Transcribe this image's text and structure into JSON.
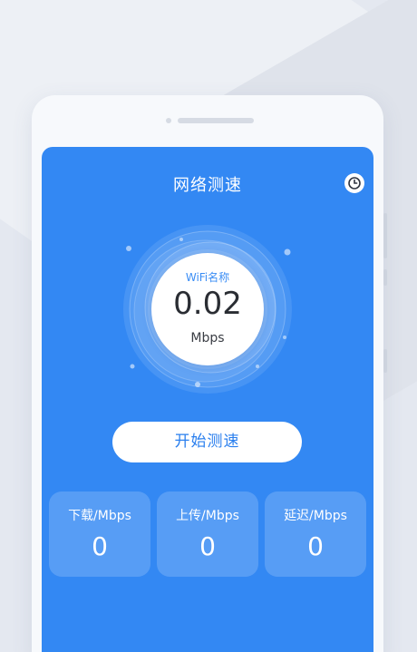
{
  "app": {
    "title": "网络测速"
  },
  "icons": {
    "history": "clock-icon"
  },
  "speed": {
    "wifi_label": "WiFi名称",
    "value": "0.02",
    "unit": "Mbps"
  },
  "actions": {
    "start_label": "开始测速"
  },
  "stats": [
    {
      "label": "下载/Mbps",
      "value": "0"
    },
    {
      "label": "上传/Mbps",
      "value": "0"
    },
    {
      "label": "延迟/Mbps",
      "value": "0"
    }
  ],
  "colors": {
    "accent": "#3388f3",
    "page_background": "#e4e8f0",
    "phone_frame": "#f7f9fc",
    "button_text": "#2a7fee"
  }
}
